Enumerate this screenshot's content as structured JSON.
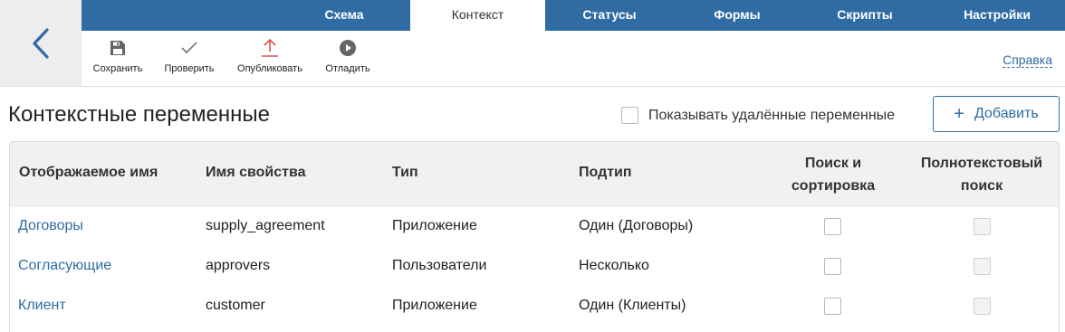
{
  "tabs": [
    {
      "label": "Схема",
      "active": false
    },
    {
      "label": "Контекст",
      "active": true
    },
    {
      "label": "Статусы",
      "active": false
    },
    {
      "label": "Формы",
      "active": false
    },
    {
      "label": "Скрипты",
      "active": false
    },
    {
      "label": "Настройки",
      "active": false
    }
  ],
  "toolbar": {
    "save_label": "Сохранить",
    "check_label": "Проверить",
    "publish_label": "Опубликовать",
    "debug_label": "Отладить",
    "help_label": "Справка"
  },
  "icons": {
    "back": "chevron-left-icon",
    "save": "floppy-disk-icon",
    "check": "checkmark-icon",
    "publish": "upload-arrow-icon",
    "debug": "play-circle-icon"
  },
  "page": {
    "title": "Контекстные переменные",
    "show_deleted_label": "Показывать удалённые переменные",
    "add_label": "Добавить"
  },
  "table": {
    "headers": {
      "display_name": "Отображаемое имя",
      "property_name": "Имя свойства",
      "type": "Тип",
      "subtype": "Подтип",
      "search_sort_line1": "Поиск и",
      "search_sort_line2": "сортировка",
      "fulltext_line1": "Полнотекстовый",
      "fulltext_line2": "поиск"
    },
    "rows": [
      {
        "display_name": "Договоры",
        "property_name": "supply_agreement",
        "type": "Приложение",
        "subtype": "Один (Договоры)"
      },
      {
        "display_name": "Согласующие",
        "property_name": "approvers",
        "type": "Пользователи",
        "subtype": "Несколько"
      },
      {
        "display_name": "Клиент",
        "property_name": "customer",
        "type": "Приложение",
        "subtype": "Один (Клиенты)"
      }
    ]
  },
  "colors": {
    "accent": "#2f6ca4",
    "publish_icon": "#d9534f",
    "header_bg": "#f1f1f1"
  }
}
